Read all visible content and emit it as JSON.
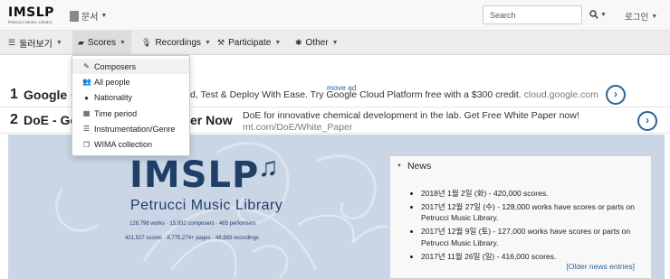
{
  "header": {
    "logo_text": "IMSLP",
    "logo_subtitle": "Petrucci Music Library",
    "doc_menu_label": "문서",
    "search_placeholder": "Search",
    "login_label": "로그인"
  },
  "nav": {
    "items": [
      {
        "label": "둘러보기",
        "icon": "bars-icon"
      },
      {
        "label": "Scores",
        "icon": "book-icon"
      },
      {
        "label": "Recordings",
        "icon": "microphone-icon"
      },
      {
        "label": "Participate",
        "icon": "hammer-icon"
      },
      {
        "label": "Other",
        "icon": "asterisk-icon"
      }
    ]
  },
  "scores_menu": {
    "items": [
      {
        "label": "Composers",
        "icon": "pencil-icon"
      },
      {
        "label": "All people",
        "icon": "users-icon"
      },
      {
        "label": "Nationality",
        "icon": "globe-icon"
      },
      {
        "label": "Time period",
        "icon": "calendar-icon"
      },
      {
        "label": "Instrumentation/Genre",
        "icon": "list-icon"
      },
      {
        "label": "WIMA collection",
        "icon": "copy-icon"
      }
    ]
  },
  "ads": {
    "move_ad_label": "move ad",
    "items": [
      {
        "number": "1",
        "title": "Google C",
        "description": "d, Test & Deploy With Ease. Try Google Cloud Platform free with a $300 credit.",
        "url": "cloud.google.com"
      },
      {
        "number": "2",
        "title": "DoE - Ge",
        "title_end": "er Now",
        "description": "DoE for innovative chemical development in the lab. Get Free White Paper now!",
        "url": "mt.com/DoE/White_Paper"
      }
    ]
  },
  "banner": {
    "title": "IMSLP",
    "subtitle": "Petrucci Music Library",
    "stats_line1": "128,796 works · 15,932 composers · 465 performers",
    "stats_line2": "421,527 scores · 8,775,274+ pages · 48,883 recordings"
  },
  "news": {
    "heading": "News",
    "items": [
      "2018년 1월 2일 (화) - 420,000 scores.",
      "2017년 12월 27일 (수) - 128,000 works have scores or parts on Petrucci Music Library.",
      "2017년 12월 9일 (토) - 127,000 works have scores or parts on Petrucci Music Library.",
      "2017년 11월 26일 (일) - 416,000 scores."
    ],
    "older_link": "[Older news entries]"
  }
}
